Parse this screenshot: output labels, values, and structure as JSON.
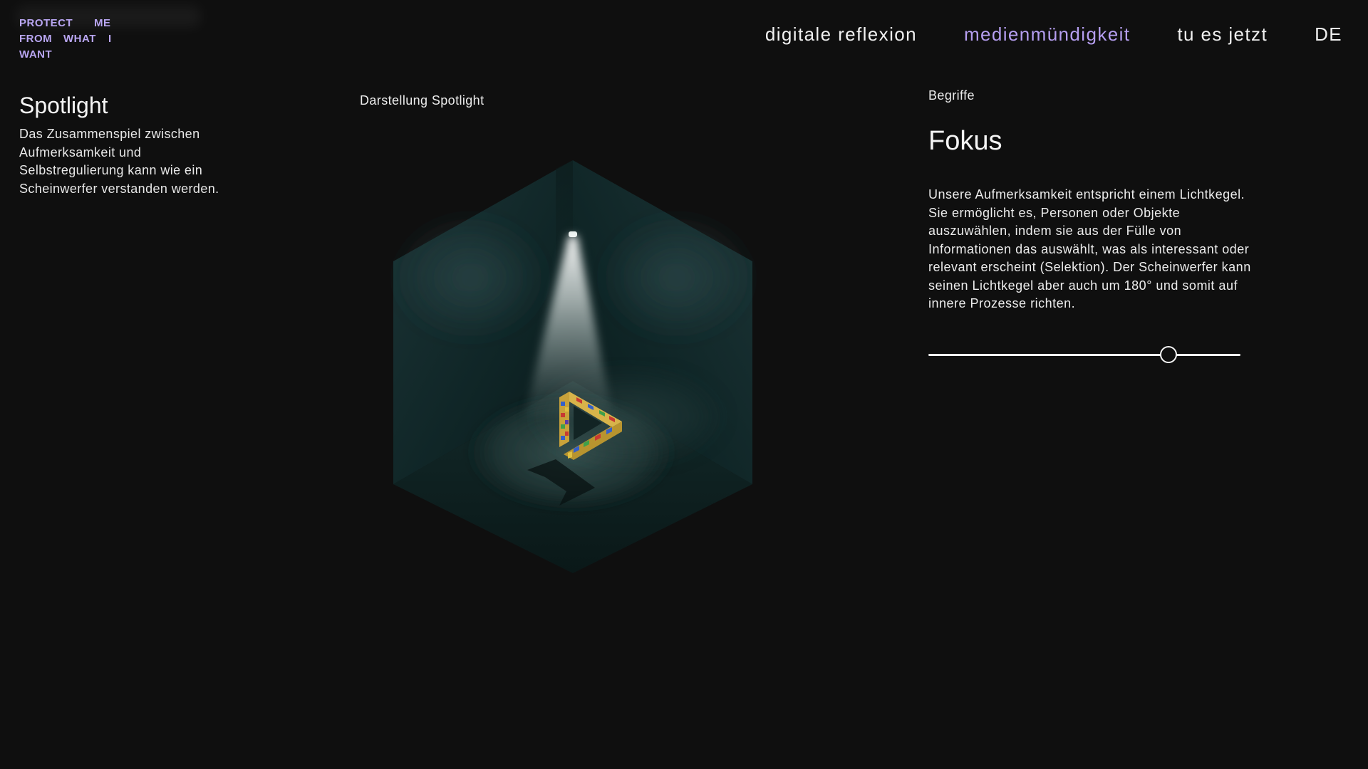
{
  "logo": {
    "words": [
      "PROTECT",
      "ME",
      "FROM",
      "WHAT",
      "I",
      "WANT"
    ],
    "color": "#b9a6f2"
  },
  "nav": {
    "items": [
      {
        "label": "digitale reflexion",
        "active": false
      },
      {
        "label": "medienmündigkeit",
        "active": true
      },
      {
        "label": "tu es jetzt",
        "active": false
      }
    ],
    "language": "DE",
    "active_color": "#b59ef0"
  },
  "intro": {
    "title": "Spotlight",
    "text": "Das Zusammenspiel zwischen Aufmerksamkeit und Selbstregulierung kann wie ein Scheinwerfer verstanden werden."
  },
  "visualization": {
    "label": "Darstellung Spotlight",
    "room_color": "#0f2222",
    "beam_color": "#ffffff",
    "object": "penrose-triangle-blocks"
  },
  "terms": {
    "section_label": "Begriffe",
    "title": "Fokus",
    "text": "Unsere Aufmerksamkeit entspricht einem Lichtkegel. Sie ermöglicht es, Personen oder Objekte auszuwählen, indem sie aus der Fülle von Informationen das auswählt, was als interessant oder relevant erscheint (Selektion). Der Scheinwerfer kann seinen Lichtkegel aber auch um 180° und somit auf innere Prozesse richten.",
    "slider_value": 0.77
  }
}
